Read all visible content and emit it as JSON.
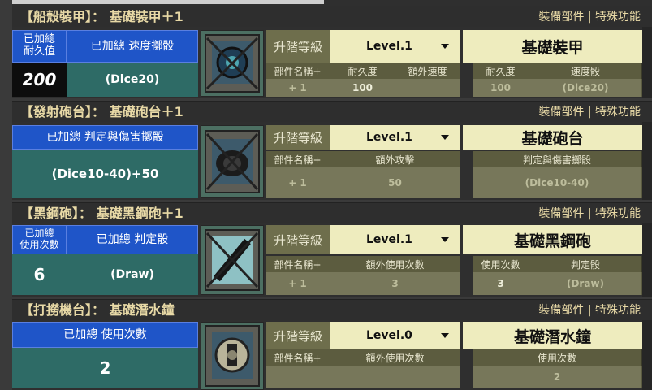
{
  "window": {
    "header_links": [
      "裝備部件",
      "|",
      "特殊功能"
    ]
  },
  "upgrade_label": "升階等級",
  "panels": [
    {
      "title": "【船殼裝甲】： 基礎裝甲＋1",
      "stat_label_1": "已加總\n耐久值",
      "stat_value_1": "200",
      "stat_label_2": "已加總 速度擲骰",
      "stat_value_2": "(Dice20)",
      "icon": "armor-icon",
      "level": "Level.1",
      "name": "基礎裝甲",
      "cols": [
        "部件名稱+",
        "耐久度",
        "額外速度"
      ],
      "vals": [
        "+ 1",
        "100",
        ""
      ],
      "rcols": [
        "耐久度",
        "速度骰"
      ],
      "rvals": [
        "100",
        "(Dice20)"
      ]
    },
    {
      "title": "【發射砲台】： 基礎砲台＋1",
      "stat_label": "已加總 判定與傷害擲骰",
      "stat_value": "(Dice10-40)+50",
      "icon": "cannon-icon",
      "level": "Level.1",
      "name": "基礎砲台",
      "cols": [
        "部件名稱+",
        "額外攻擊"
      ],
      "vals": [
        "+ 1",
        "50"
      ],
      "rcols": [
        "判定與傷害擲骰"
      ],
      "rvals": [
        "(Dice10-40)"
      ]
    },
    {
      "title": "【黑鋼砲】： 基礎黑鋼砲＋1",
      "stat_label_1": "已加總\n使用次數",
      "stat_value_1": "6",
      "stat_label_2": "已加總 判定骰",
      "stat_value_2": "(Draw)",
      "icon": "black-steel-cannon-icon",
      "level": "Level.1",
      "name": "基礎黑鋼砲",
      "cols": [
        "部件名稱+",
        "額外使用次數"
      ],
      "vals": [
        "+ 1",
        "3"
      ],
      "rcols": [
        "使用次數",
        "判定骰"
      ],
      "rvals": [
        "3",
        "(Draw)"
      ]
    },
    {
      "title": "【打撈機台】： 基礎潛水鐘",
      "stat_label": "已加總 使用次數",
      "stat_value": "2",
      "icon": "diving-bell-icon",
      "level": "Level.0",
      "name": "基礎潛水鐘",
      "cols": [
        "部件名稱+",
        "額外使用次數"
      ],
      "vals": [
        "",
        ""
      ],
      "rcols": [
        "使用次數"
      ],
      "rvals": [
        "2"
      ]
    }
  ]
}
